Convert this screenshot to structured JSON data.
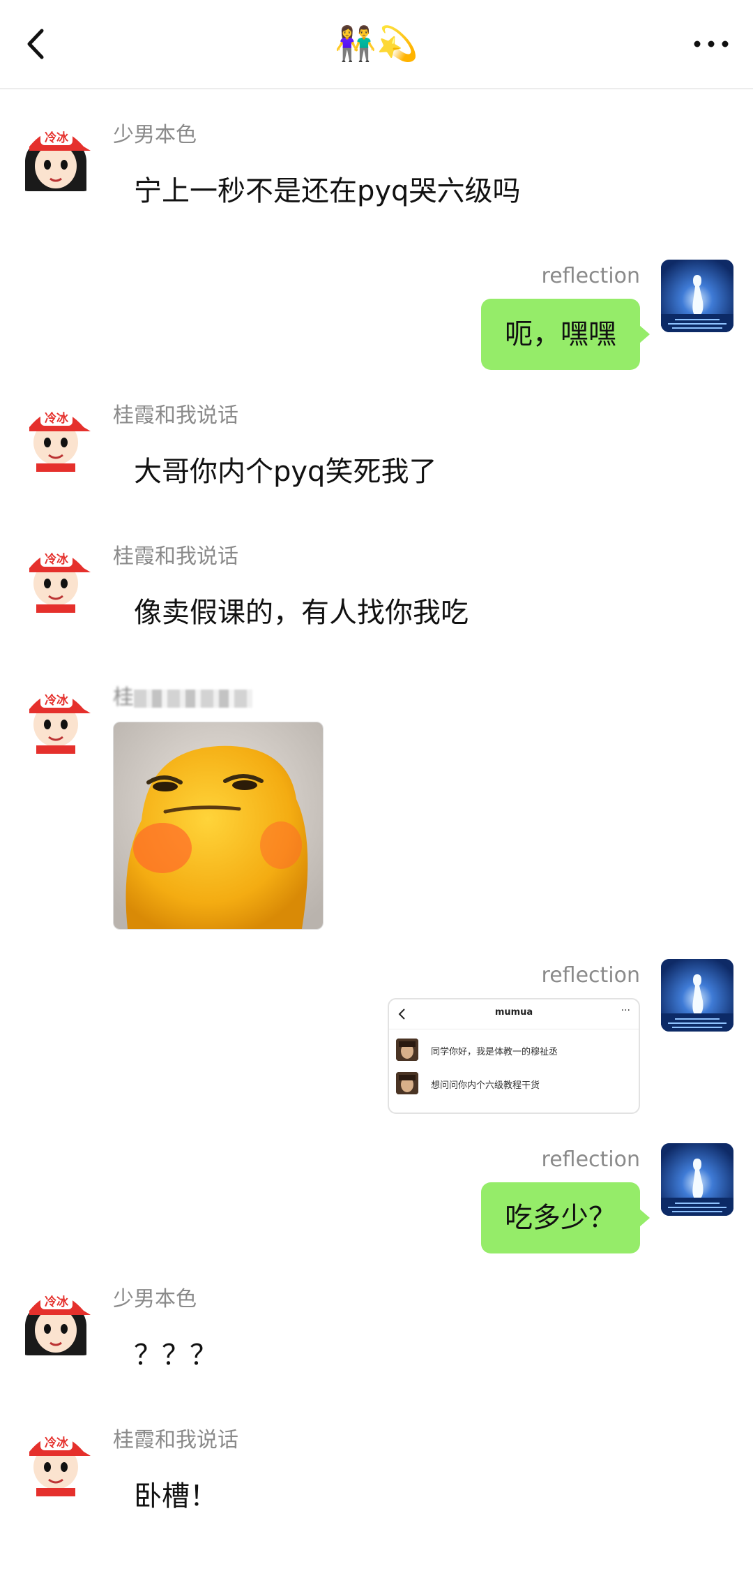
{
  "header": {
    "title": "👫💫",
    "back_icon": "chevron-left-icon",
    "more_icon": "ellipsis-icon"
  },
  "colors": {
    "bubble_self": "#95ec69",
    "sender_name": "#8a8a8a",
    "avatar_self_bg": "#1b3d8a",
    "avatar_cap_red": "#e5302c"
  },
  "messages": [
    {
      "sender": "少男本色",
      "text": "宁上一秒不是还在pyq哭六级吗"
    },
    {
      "sender": "reflection",
      "text": "呃，嘿嘿"
    },
    {
      "sender": "桂霞和我说话",
      "text": "大哥你内个pyq笑死我了"
    },
    {
      "sender": "桂霞和我说话",
      "text": "像卖假课的，有人找你我吃"
    },
    {
      "sender_prefix": "桂",
      "sticker_icon": "smug-yellow-creature-sticker"
    },
    {
      "sender": "reflection",
      "screenshot": {
        "title": "mumua",
        "rows": [
          "同学你好，我是体教一的穆祉丞",
          "想问问你内个六级教程干货"
        ]
      }
    },
    {
      "sender": "reflection",
      "text": "吃多少？"
    },
    {
      "sender": "少男本色",
      "text": "？？？"
    },
    {
      "sender": "桂霞和我说话",
      "text": "卧槽！"
    }
  ],
  "avatar_labels": {
    "cap_text": "冷冰"
  }
}
